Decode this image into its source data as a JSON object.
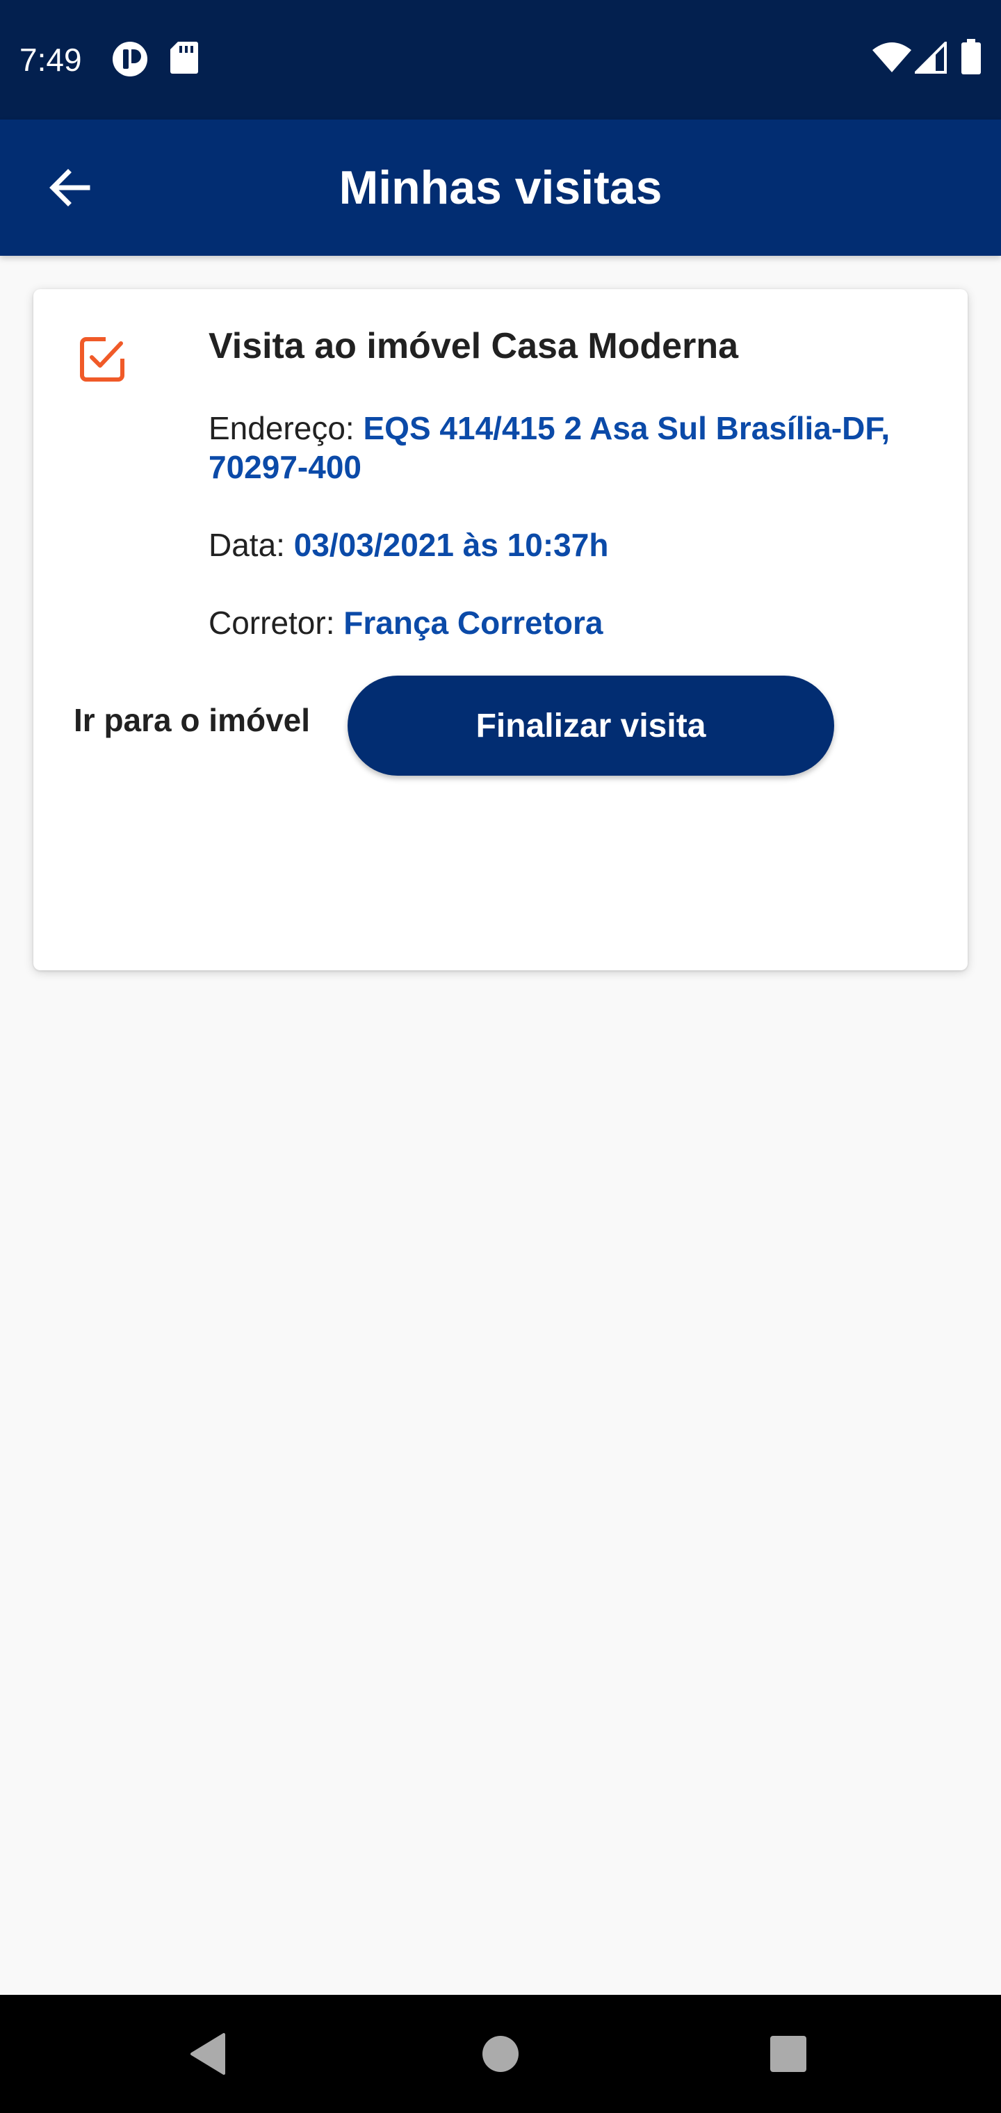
{
  "status_bar": {
    "time": "7:49",
    "left_icons": [
      "media-app-icon",
      "sd-card-icon"
    ],
    "right_icons": [
      "wifi-icon",
      "signal-icon",
      "battery-icon"
    ]
  },
  "app_bar": {
    "title": "Minhas visitas",
    "back_icon": "arrow-back-icon"
  },
  "visit_card": {
    "icon": "checkbox-checked-icon",
    "title": "Visita ao imóvel Casa Moderna",
    "address_label": "Endereço: ",
    "address_value": "EQS 414/415 2 Asa Sul Brasília-DF, 70297-400",
    "date_label": "Data: ",
    "date_value": "03/03/2021 às 10:37h",
    "broker_label": "Corretor: ",
    "broker_value": "França Corretora",
    "go_to_property_label": "Ir para o imóvel",
    "finish_button_label": "Finalizar visita"
  },
  "navigation_bar": {
    "buttons": [
      "back-triangle-icon",
      "home-circle-icon",
      "recents-square-icon"
    ]
  },
  "colors": {
    "status_bar": "#03204f",
    "app_bar": "#022d72",
    "accent_orange": "#f05a28",
    "link_blue": "#0b4aa8",
    "background": "#f9f9f9"
  }
}
